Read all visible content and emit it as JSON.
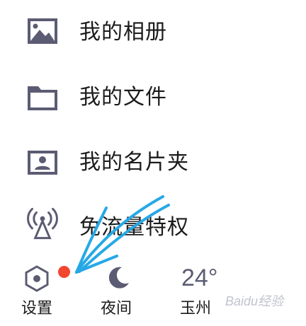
{
  "menu": {
    "items": [
      {
        "label": "我的相册",
        "icon": "image-icon"
      },
      {
        "label": "我的文件",
        "icon": "folder-icon"
      },
      {
        "label": "我的名片夹",
        "icon": "contact-card-icon"
      },
      {
        "label": "免流量特权",
        "icon": "broadcast-antenna-icon"
      }
    ]
  },
  "bottom": {
    "settings_label": "设置",
    "night_label": "夜间",
    "weather_temp": "24°",
    "weather_city": "玉州"
  },
  "colors": {
    "icon": "#5b5c73",
    "badge": "#f2472f",
    "annotation_arrow": "#27a8e6"
  },
  "watermark": "Baidu经验"
}
